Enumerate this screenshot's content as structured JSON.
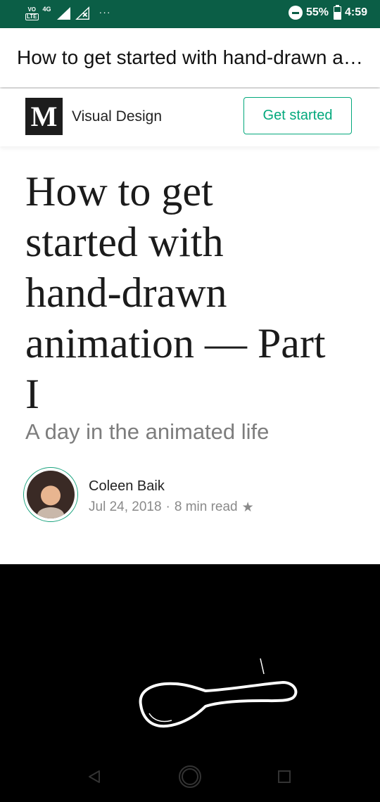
{
  "status_bar": {
    "volte_top": "VO",
    "volte_bottom": "LTE",
    "network": "4G",
    "overflow": "···",
    "battery_percent": "55%",
    "battery_level": 0.55,
    "time": "4:59",
    "icons": [
      "volte-icon",
      "signal-icon",
      "no-signal-icon",
      "overflow-icon",
      "dnd-icon",
      "battery-icon"
    ]
  },
  "browser": {
    "page_title": "How to get started with hand-drawn animation — Part I"
  },
  "header": {
    "logo": "M",
    "publication": "Visual Design",
    "cta": "Get started",
    "accent": "#03a87c"
  },
  "article": {
    "title_lines": [
      "How to get",
      "started with",
      "hand-drawn",
      "animation — Part",
      "I"
    ],
    "subtitle": "A day in the animated life",
    "author": "Coleen Baik",
    "date": "Jul 24, 2018",
    "separator": "·",
    "read_time": "8 min read",
    "star": "★"
  },
  "nav": {
    "icons": [
      "back-icon",
      "home-icon",
      "recents-icon"
    ]
  },
  "colors": {
    "status_bar": "#0b5e46",
    "hero_bg": "#000000"
  }
}
